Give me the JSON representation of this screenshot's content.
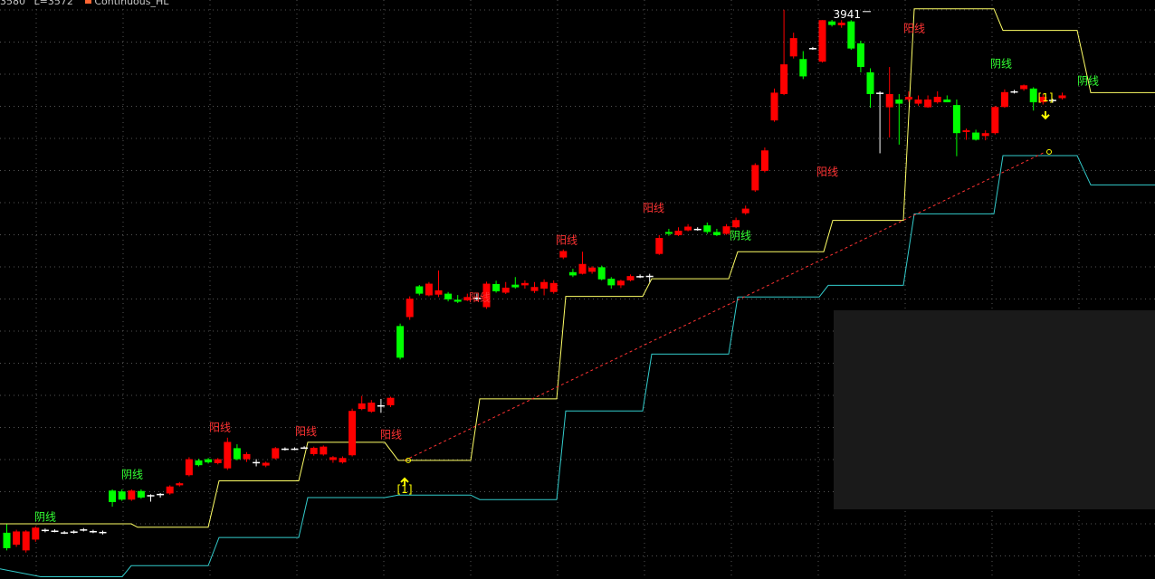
{
  "header": {
    "high_text": "3580",
    "low_text": "L=3572",
    "indicator_name": "Continuous_HL",
    "indicator_color": "#ff6633"
  },
  "colors": {
    "background": "#000000",
    "grid": "#555555",
    "up_candle": "#ff0000",
    "down_candle": "#00ff00",
    "doji": "#ffffff",
    "upper_band": "#ffff66",
    "lower_band": "#33cccc",
    "trend_line": "#ff3333",
    "signal_marker": "#ffff00",
    "up_label": "#ff3333",
    "down_label": "#33ff33"
  },
  "chart_data": {
    "type": "candlestick",
    "y_scale": "log",
    "ylim": [
      2220,
      3980
    ],
    "peak_label": "3941",
    "peak_value": 3941,
    "candles": [
      [
        2326,
        2290,
        2346,
        2285
      ],
      [
        2298,
        2329,
        2333,
        2293
      ],
      [
        2285,
        2329,
        2332,
        2280
      ],
      [
        2310,
        2338,
        2341,
        2305
      ],
      [
        2331,
        2333,
        2336,
        2327
      ],
      [
        2330,
        2331,
        2334,
        2327
      ],
      [
        2325,
        2327,
        2330,
        2323
      ],
      [
        2327,
        2329,
        2332,
        2324
      ],
      [
        2334,
        2332,
        2337,
        2329
      ],
      [
        2328,
        2330,
        2333,
        2325
      ],
      [
        2325,
        2328,
        2331,
        2322
      ],
      [
        2427,
        2399,
        2430,
        2388
      ],
      [
        2425,
        2405,
        2430,
        2402
      ],
      [
        2405,
        2427,
        2430,
        2402
      ],
      [
        2426,
        2410,
        2430,
        2407
      ],
      [
        2414,
        2416,
        2418,
        2400
      ],
      [
        2417,
        2419,
        2421,
        2410
      ],
      [
        2420,
        2437,
        2440,
        2417
      ],
      [
        2440,
        2445,
        2448,
        2437
      ],
      [
        2465,
        2505,
        2510,
        2462
      ],
      [
        2502,
        2490,
        2506,
        2487
      ],
      [
        2505,
        2497,
        2508,
        2494
      ],
      [
        2495,
        2505,
        2508,
        2492
      ],
      [
        2482,
        2549,
        2560,
        2478
      ],
      [
        2533,
        2505,
        2543,
        2502
      ],
      [
        2505,
        2518,
        2523,
        2498
      ],
      [
        2495,
        2498,
        2505,
        2487
      ],
      [
        2489,
        2496,
        2499,
        2485
      ],
      [
        2507,
        2533,
        2536,
        2504
      ],
      [
        2530,
        2532,
        2535,
        2527
      ],
      [
        2532,
        2530,
        2535,
        2528
      ],
      [
        2535,
        2533,
        2538,
        2531
      ],
      [
        2518,
        2534,
        2537,
        2514
      ],
      [
        2517,
        2537,
        2540,
        2514
      ],
      [
        2503,
        2510,
        2513,
        2496
      ],
      [
        2497,
        2508,
        2512,
        2494
      ],
      [
        2515,
        2630,
        2636,
        2512
      ],
      [
        2635,
        2650,
        2670,
        2632
      ],
      [
        2628,
        2652,
        2659,
        2625
      ],
      [
        2643,
        2645,
        2662,
        2625
      ],
      [
        2645,
        2665,
        2668,
        2640
      ],
      [
        2865,
        2775,
        2872,
        2770
      ],
      [
        2891,
        2945,
        2952,
        2883
      ],
      [
        2982,
        2960,
        2986,
        2955
      ],
      [
        2955,
        2990,
        2995,
        2952
      ],
      [
        2957,
        2970,
        3030,
        2950
      ],
      [
        2960,
        2943,
        2965,
        2937
      ],
      [
        2942,
        2936,
        2956,
        2932
      ],
      [
        2940,
        2950,
        2960,
        2938
      ],
      [
        2945,
        2948,
        2960,
        2940
      ],
      [
        2920,
        2990,
        2996,
        2915
      ],
      [
        2989,
        2967,
        2999,
        2963
      ],
      [
        2963,
        2978,
        2995,
        2959
      ],
      [
        2987,
        2979,
        3010,
        2975
      ],
      [
        2985,
        2992,
        3000,
        2975
      ],
      [
        2968,
        2980,
        2995,
        2962
      ],
      [
        2975,
        2995,
        3003,
        2955
      ],
      [
        2965,
        2992,
        3000,
        2960
      ],
      [
        3070,
        3090,
        3095,
        3065
      ],
      [
        3025,
        3015,
        3035,
        3010
      ],
      [
        3020,
        3050,
        3088,
        3018
      ],
      [
        3026,
        3039,
        3043,
        3020
      ],
      [
        3040,
        3003,
        3045,
        3000
      ],
      [
        3005,
        2985,
        3010,
        2975
      ],
      [
        2985,
        2999,
        3002,
        2977
      ],
      [
        3000,
        3013,
        3018,
        2997
      ],
      [
        3013,
        3011,
        3018,
        3007
      ],
      [
        3010,
        3014,
        3020,
        2995
      ],
      [
        3081,
        3131,
        3140,
        3078
      ],
      [
        3150,
        3144,
        3160,
        3138
      ],
      [
        3140,
        3154,
        3165,
        3137
      ],
      [
        3155,
        3167,
        3175,
        3152
      ],
      [
        3160,
        3157,
        3165,
        3154
      ],
      [
        3171,
        3150,
        3180,
        3144
      ],
      [
        3150,
        3140,
        3160,
        3137
      ],
      [
        3144,
        3168,
        3175,
        3141
      ],
      [
        3165,
        3188,
        3196,
        3162
      ],
      [
        3210,
        3225,
        3235,
        3205
      ],
      [
        3285,
        3370,
        3376,
        3280
      ],
      [
        3350,
        3420,
        3430,
        3345
      ],
      [
        3525,
        3625,
        3640,
        3520
      ],
      [
        3620,
        3730,
        3941,
        3616
      ],
      [
        3760,
        3830,
        3851,
        3752
      ],
      [
        3750,
        3685,
        3780,
        3675
      ],
      [
        3790,
        3792,
        3796,
        3785
      ],
      [
        3740,
        3900,
        3900,
        3737
      ],
      [
        3895,
        3881,
        3901,
        3875
      ],
      [
        3880,
        3890,
        3900,
        3870
      ],
      [
        3895,
        3790,
        3900,
        3785
      ],
      [
        3810,
        3720,
        3820,
        3700
      ],
      [
        3700,
        3620,
        3715,
        3570
      ],
      [
        3625,
        3625,
        3630,
        3410
      ],
      [
        3572,
        3620,
        3720,
        3465
      ],
      [
        3600,
        3585,
        3620,
        3440
      ],
      [
        3600,
        3610,
        3630,
        3592
      ],
      [
        3585,
        3600,
        3615,
        3578
      ],
      [
        3572,
        3600,
        3615,
        3570
      ],
      [
        3590,
        3610,
        3630,
        3585
      ],
      [
        3600,
        3590,
        3615,
        3590
      ],
      [
        3580,
        3480,
        3600,
        3400
      ],
      [
        3484,
        3490,
        3496,
        3457
      ],
      [
        3482,
        3457,
        3492,
        3454
      ],
      [
        3470,
        3480,
        3490,
        3455
      ],
      [
        3480,
        3573,
        3577,
        3475
      ],
      [
        3573,
        3627,
        3637,
        3570
      ],
      [
        3627,
        3630,
        3635,
        3622
      ],
      [
        3638,
        3652,
        3655,
        3632
      ],
      [
        3640,
        3590,
        3645,
        3560
      ],
      [
        3590,
        3610,
        3620,
        3582
      ],
      [
        3595,
        3599,
        3603,
        3588
      ],
      [
        3605,
        3615,
        3625,
        3600
      ]
    ],
    "upper_band_points": [
      [
        0,
        2347
      ],
      [
        145,
        2347
      ],
      [
        152,
        2339
      ],
      [
        230,
        2339
      ],
      [
        242,
        2451
      ],
      [
        330,
        2451
      ],
      [
        340,
        2548
      ],
      [
        425,
        2548
      ],
      [
        440,
        2502
      ],
      [
        520,
        2502
      ],
      [
        530,
        2662
      ],
      [
        615,
        2662
      ],
      [
        625,
        2952
      ],
      [
        710,
        2952
      ],
      [
        720,
        3005
      ],
      [
        805,
        3005
      ],
      [
        815,
        3088
      ],
      [
        910,
        3088
      ],
      [
        920,
        3187
      ],
      [
        998,
        3187
      ],
      [
        1010,
        3945
      ],
      [
        1098,
        3945
      ],
      [
        1108,
        3860
      ],
      [
        1190,
        3860
      ],
      [
        1205,
        3625
      ],
      [
        1276,
        3625
      ]
    ],
    "lower_band_points": [
      [
        0,
        2243
      ],
      [
        45,
        2225
      ],
      [
        135,
        2225
      ],
      [
        145,
        2250
      ],
      [
        230,
        2250
      ],
      [
        242,
        2315
      ],
      [
        330,
        2315
      ],
      [
        340,
        2410
      ],
      [
        425,
        2410
      ],
      [
        440,
        2416
      ],
      [
        520,
        2416
      ],
      [
        530,
        2405
      ],
      [
        615,
        2405
      ],
      [
        625,
        2630
      ],
      [
        710,
        2630
      ],
      [
        720,
        2785
      ],
      [
        805,
        2785
      ],
      [
        815,
        2950
      ],
      [
        905,
        2950
      ],
      [
        915,
        2985
      ],
      [
        998,
        2985
      ],
      [
        1010,
        3208
      ],
      [
        1098,
        3208
      ],
      [
        1108,
        3402
      ],
      [
        1190,
        3402
      ],
      [
        1205,
        3303
      ],
      [
        1276,
        3303
      ]
    ],
    "trend_line": [
      [
        447,
        2502
      ],
      [
        1155,
        3415
      ]
    ],
    "signal_markers": [
      {
        "x": 447,
        "value": 2502,
        "label": "[1]",
        "direction": "up"
      },
      {
        "x": 1155,
        "value": 3415,
        "label": "[1]",
        "direction": "down"
      }
    ],
    "annotations": [
      {
        "text": "阴线",
        "x": 50,
        "value": 2355,
        "kind": "down"
      },
      {
        "text": "阴线",
        "x": 146,
        "value": 2458,
        "kind": "down"
      },
      {
        "text": "阳线",
        "x": 243,
        "value": 2577,
        "kind": "up"
      },
      {
        "text": "阳线",
        "x": 338,
        "value": 2567,
        "kind": "up"
      },
      {
        "text": "阳线",
        "x": 432,
        "value": 2558,
        "kind": "up"
      },
      {
        "text": "阳线",
        "x": 530,
        "value": 2937,
        "kind": "up"
      },
      {
        "text": "阳线",
        "x": 626,
        "value": 3112,
        "kind": "up"
      },
      {
        "text": "阳线",
        "x": 722,
        "value": 3215,
        "kind": "up"
      },
      {
        "text": "阴线",
        "x": 818,
        "value": 3127,
        "kind": "down"
      },
      {
        "text": "阳线",
        "x": 914,
        "value": 3335,
        "kind": "up"
      },
      {
        "text": "阳线",
        "x": 1010,
        "value": 3853,
        "kind": "up"
      },
      {
        "text": "阴线",
        "x": 1106,
        "value": 3718,
        "kind": "down"
      },
      {
        "text": "阴线",
        "x": 1202,
        "value": 3655,
        "kind": "down"
      }
    ]
  }
}
